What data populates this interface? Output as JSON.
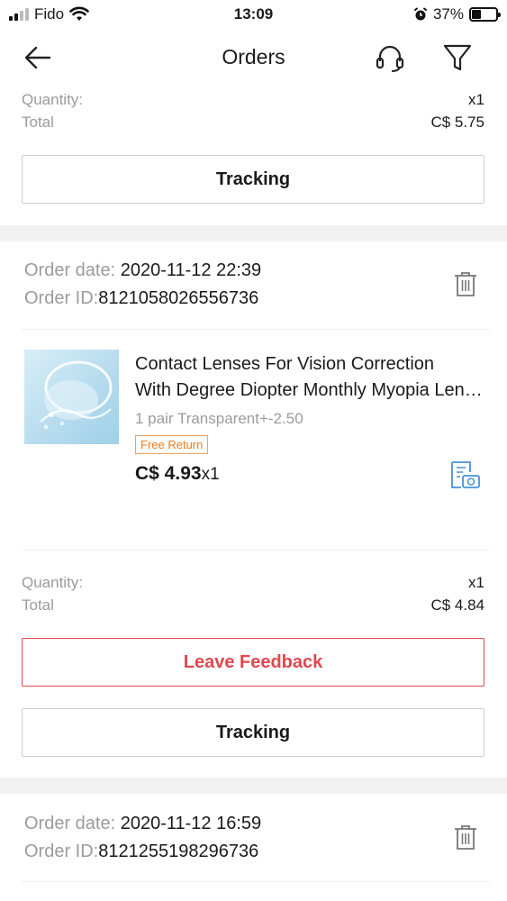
{
  "status_bar": {
    "carrier": "Fido",
    "time": "13:09",
    "battery_percent": "37%",
    "icons": [
      "signal-icon",
      "wifi-icon",
      "alarm-icon",
      "battery-icon"
    ]
  },
  "nav": {
    "title": "Orders",
    "icons": [
      "back-arrow-icon",
      "support-headset-icon",
      "filter-icon"
    ]
  },
  "previous_order": {
    "quantity_label": "Quantity:",
    "quantity_value": "x1",
    "total_label": "Total",
    "total_value": "C$ 5.75",
    "tracking_label": "Tracking"
  },
  "order_1": {
    "date_label": "Order date: ",
    "date_value": "2020-11-12 22:39",
    "id_label": "Order ID:",
    "id_value": "8121058026556736",
    "product": {
      "title_line1": "Contact Lenses For Vision Correction",
      "title_line2": "With Degree Diopter Monthly Myopia Lenses",
      "sku": "1 pair Transparent+-2.50",
      "badge": "Free Return",
      "price": "C$ 4.93",
      "qty": "x1"
    },
    "quantity_label": "Quantity:",
    "quantity_value": "x1",
    "total_label": "Total",
    "total_value": "C$ 4.84",
    "feedback_label": "Leave Feedback",
    "tracking_label": "Tracking"
  },
  "order_2": {
    "date_label": "Order date: ",
    "date_value": "2020-11-12 16:59",
    "id_label": "Order ID:",
    "id_value": "8121255198296736"
  },
  "colors": {
    "accent_red": "#e0474f",
    "badge_orange": "#f07a1a",
    "muted_text": "#9b9b9b",
    "icon_blue": "#4a90d9"
  }
}
